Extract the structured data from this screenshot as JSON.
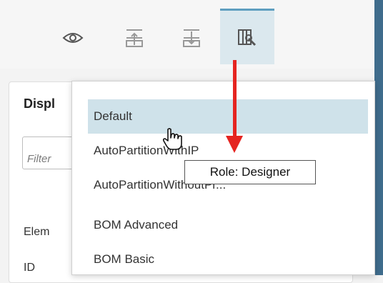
{
  "toolbar": {
    "icons": [
      {
        "name": "eye-icon"
      },
      {
        "name": "expand-top-icon"
      },
      {
        "name": "expand-bottom-icon"
      },
      {
        "name": "role-settings-icon",
        "active": true
      }
    ],
    "accent_color": "#5f9fc0",
    "active_bg": "#dbe8ee"
  },
  "background_panel": {
    "title": "Displ",
    "filter_placeholder": "Filter",
    "labels": [
      "Elem",
      "ID"
    ]
  },
  "dropdown": {
    "items": [
      {
        "label": "Default",
        "selected": true
      },
      {
        "label": "AutoPartitionWithIP"
      },
      {
        "label": "AutoPartitionWithoutPr..."
      },
      {
        "label": "BOM Advanced"
      },
      {
        "label": "BOM Basic"
      }
    ]
  },
  "tooltip": {
    "text": "Role: Designer"
  },
  "annotation": {
    "arrow_color": "#e52420"
  }
}
